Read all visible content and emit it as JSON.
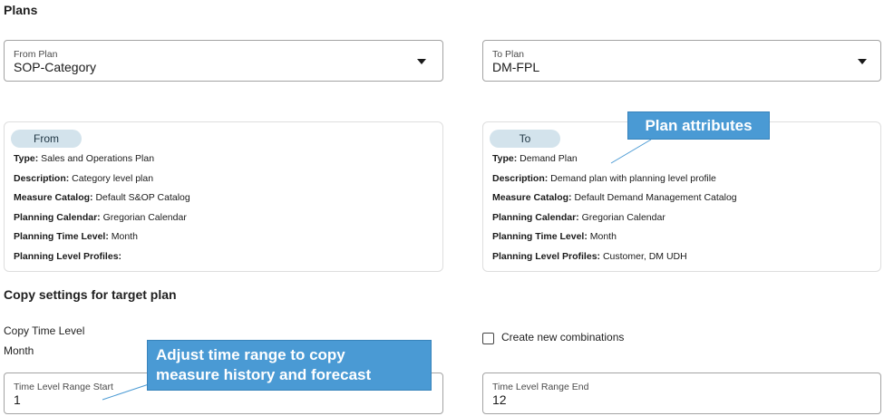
{
  "section_plans": "Plans",
  "from_plan": {
    "label": "From Plan",
    "value": "SOP-Category"
  },
  "to_plan": {
    "label": "To Plan",
    "value": "DM-FPL"
  },
  "from_card": {
    "pill": "From",
    "rows": [
      {
        "k": "Type:",
        "v": " Sales and Operations Plan"
      },
      {
        "k": "Description:",
        "v": " Category level plan"
      },
      {
        "k": "Measure Catalog:",
        "v": " Default S&OP Catalog"
      },
      {
        "k": "Planning Calendar:",
        "v": " Gregorian Calendar"
      },
      {
        "k": "Planning Time Level:",
        "v": " Month"
      },
      {
        "k": "Planning Level Profiles:",
        "v": ""
      }
    ]
  },
  "to_card": {
    "pill": "To",
    "rows": [
      {
        "k": "Type:",
        "v": " Demand Plan"
      },
      {
        "k": "Description:",
        "v": " Demand plan with planning level profile"
      },
      {
        "k": "Measure Catalog:",
        "v": " Default Demand Management Catalog"
      },
      {
        "k": "Planning Calendar:",
        "v": " Gregorian Calendar"
      },
      {
        "k": "Planning Time Level:",
        "v": " Month"
      },
      {
        "k": "Planning Level Profiles:",
        "v": " Customer, DM UDH"
      }
    ]
  },
  "callout_attributes": "Plan attributes",
  "section_copy": "Copy settings for target plan",
  "copy_time_level": {
    "label": "Copy Time Level",
    "value": "Month"
  },
  "create_combinations": "Create new combinations",
  "callout_time_range": {
    "line1": "Adjust time range to copy",
    "line2": "measure history and forecast"
  },
  "range_start": {
    "label": "Time Level Range Start",
    "value": "1"
  },
  "range_end": {
    "label": "Time Level Range End",
    "value": "12"
  },
  "colors": {
    "callout": "#4a9ad4",
    "pill": "#d3e3ec"
  }
}
